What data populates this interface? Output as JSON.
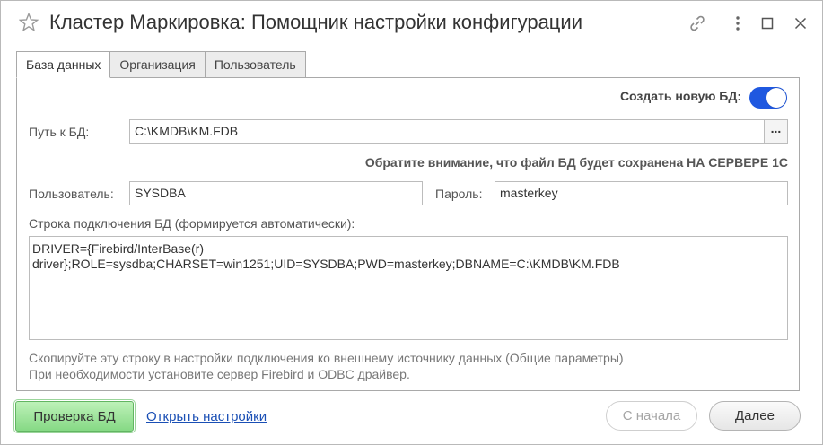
{
  "window": {
    "title": "Кластер Маркировка: Помощник настройки конфигурации"
  },
  "tabs": [
    {
      "label": "База данных",
      "active": true
    },
    {
      "label": "Организация",
      "active": false
    },
    {
      "label": "Пользователь",
      "active": false
    }
  ],
  "db": {
    "create_new_label": "Создать новую БД:",
    "create_new_on": true,
    "path_label": "Путь к БД:",
    "path_value": "C:\\KMDB\\KM.FDB",
    "browse_label": "...",
    "notice": "Обратите внимание, что файл БД будет сохранена НА СЕРВЕРЕ 1С",
    "user_label": "Пользователь:",
    "user_value": "SYSDBA",
    "password_label": "Пароль:",
    "password_value": "masterkey",
    "conn_label": "Строка подключения БД (формируется автоматически):",
    "conn_line1": "DRIVER={Firebird/InterBase(r)",
    "conn_line2": "driver};ROLE=sysdba;CHARSET=win1251;UID=SYSDBA;PWD=masterkey;DBNAME=C:\\KMDB\\KM.FDB",
    "hint1": "Скопируйте эту строку в настройки подключения ко внешнему источнику данных (Общие параметры)",
    "hint2": "При необходимости установите сервер Firebird и ODBC драйвер."
  },
  "footer": {
    "check_label": "Проверка БД",
    "open_settings_label": "Открыть настройки",
    "start_label": "С начала",
    "next_label": "Далее"
  },
  "colors": {
    "toggle_on": "#1f58e0",
    "check_button": "#9fe39c",
    "link": "#1a4fb5"
  }
}
